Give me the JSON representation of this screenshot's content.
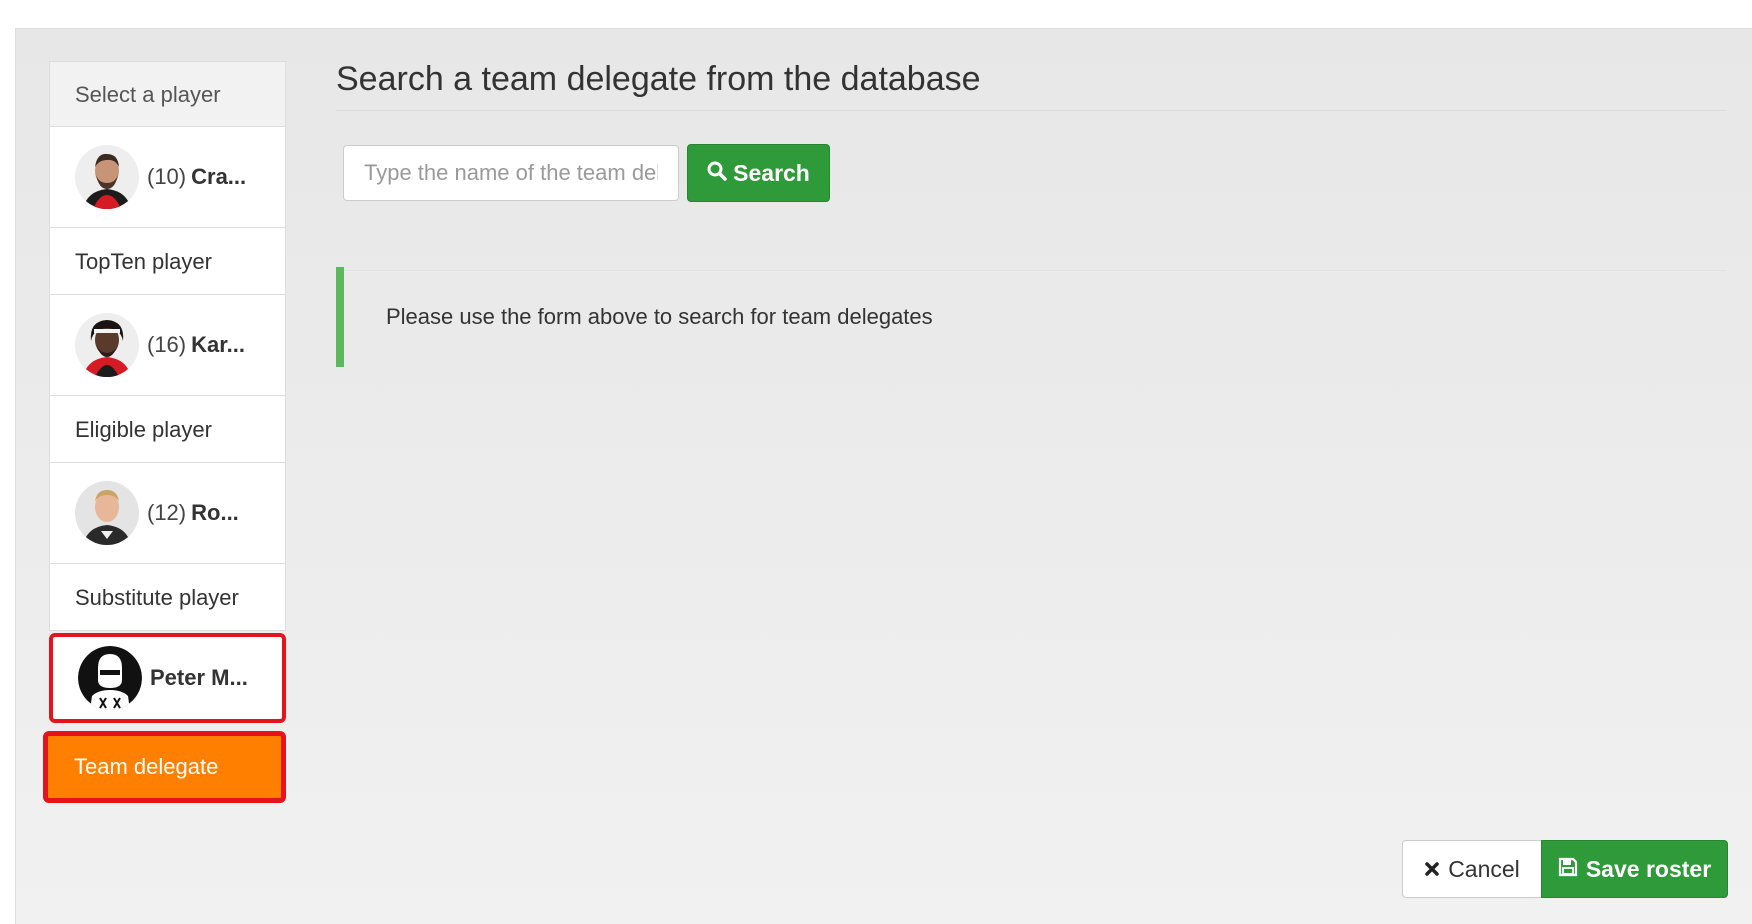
{
  "sidebar": {
    "header": "Select a player",
    "players": [
      {
        "number": "(10)",
        "name": "Cra...",
        "avatar": "player-photo-1"
      },
      {
        "number": "(16)",
        "name": "Kar...",
        "avatar": "player-photo-2"
      },
      {
        "number": "(12)",
        "name": "Ro...",
        "avatar": "player-photo-3"
      },
      {
        "number": "",
        "name": "Peter M...",
        "avatar": "placeholder-player-icon"
      }
    ],
    "labels": {
      "topten": "TopTen player",
      "eligible": "Eligible player",
      "substitute": "Substitute player",
      "delegate": "Team delegate"
    }
  },
  "main": {
    "title": "Search a team delegate from the database",
    "search": {
      "placeholder": "Type the name of the team delegate",
      "button_label": "Search",
      "button_icon": "search-icon"
    },
    "info_message": "Please use the form above to search for team delegates"
  },
  "footer": {
    "cancel_label": "Cancel",
    "cancel_icon": "close-icon",
    "save_label": "Save roster",
    "save_icon": "floppy-disk-icon"
  },
  "colors": {
    "success": "#2f9a3a",
    "accent_orange": "#ff7f00",
    "highlight_red": "#e5141c",
    "callout_border": "#5cb85c"
  }
}
